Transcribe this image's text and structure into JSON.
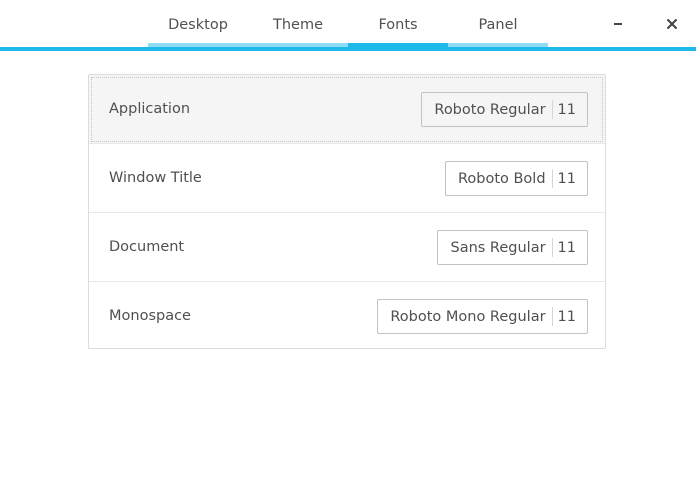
{
  "header": {
    "tabs": [
      {
        "label": "Desktop",
        "active": false
      },
      {
        "label": "Theme",
        "active": false
      },
      {
        "label": "Fonts",
        "active": true
      },
      {
        "label": "Panel",
        "active": false
      }
    ],
    "controls": {
      "minimize_icon": "minimize-icon",
      "close_icon": "close-icon"
    }
  },
  "fonts": {
    "rows": [
      {
        "label": "Application",
        "font": "Roboto Regular",
        "size": "11",
        "selected": true
      },
      {
        "label": "Window Title",
        "font": "Roboto Bold",
        "size": "11",
        "selected": false
      },
      {
        "label": "Document",
        "font": "Sans Regular",
        "size": "11",
        "selected": false
      },
      {
        "label": "Monospace",
        "font": "Roboto Mono Regular",
        "size": "11",
        "selected": false
      }
    ]
  },
  "colors": {
    "accent": "#1eb9e8",
    "accent_light": "#8fdcf5",
    "text": "#505050",
    "row_selected_bg": "#f5f5f5"
  }
}
